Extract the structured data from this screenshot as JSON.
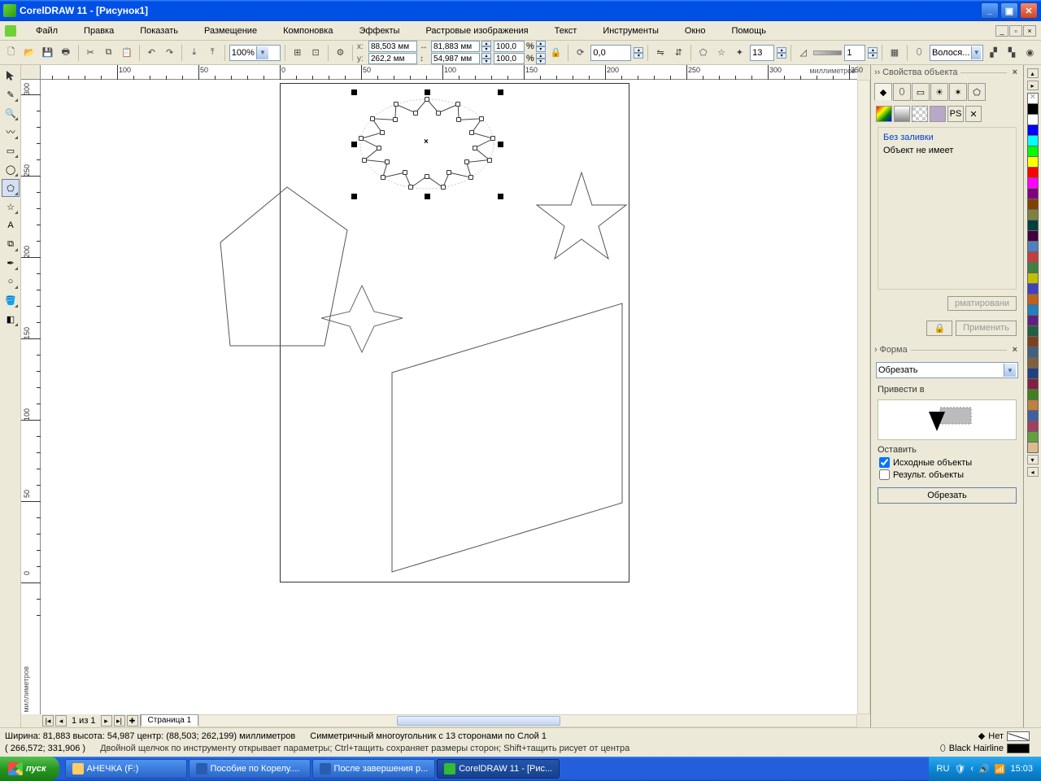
{
  "title": "CorelDRAW 11 - [Рисунок1]",
  "menu": [
    "Файл",
    "Правка",
    "Показать",
    "Размещение",
    "Компоновка",
    "Эффекты",
    "Растровые изображения",
    "Текст",
    "Инструменты",
    "Окно",
    "Помощь"
  ],
  "menu_ul": [
    "Ф",
    "П",
    "о",
    "Р",
    "К",
    "Э",
    "а",
    "Т",
    "И",
    "О",
    "ь"
  ],
  "toolbar": {
    "zoom": "100%",
    "x": "88,503 мм",
    "y": "262,2 мм",
    "w": "81,883 мм",
    "h": "54,987 мм",
    "sx": "100,0",
    "sy": "100,0",
    "pct": "%",
    "rot": "0,0",
    "sides": "13",
    "sharp": "1",
    "outline_combo": "Волося..."
  },
  "ruler_h_label": "миллиметров",
  "ruler_v_label": "миллиметров",
  "ruler_h_ticks": [
    "100",
    "50",
    "0",
    "50",
    "100",
    "150",
    "200",
    "250",
    "300"
  ],
  "ruler_v_ticks": [
    "300",
    "250",
    "200",
    "150",
    "100",
    "50",
    "0"
  ],
  "pagenav": {
    "text": "1 из 1",
    "tab": "Страница 1"
  },
  "props": {
    "title": "Свойства объекта",
    "nofill_head": "Без заливки",
    "nofill_body": "Объект не имеет",
    "fmt_btn": "рматировани",
    "apply": "Применить"
  },
  "shape": {
    "title": "Форма",
    "combo": "Обрезать",
    "lead": "Привести в",
    "leave": "Оставить",
    "cb1": "Исходные объекты",
    "cb2": "Результ. объекты",
    "btn": "Обрезать"
  },
  "status": {
    "line1a": "Ширина: 81,883  высота: 54,987  центр: (88,503; 262,199)  миллиметров",
    "line1b": "Симметричный многоугольник с 13 сторонами по Слой 1",
    "line2a": "( 266,572; 331,906 )",
    "line2b": "Двойной щелчок по инструменту открывает параметры; Ctrl+тащить сохраняет размеры сторон; Shift+тащить рисует от центра",
    "fill_none": "Нет",
    "outline": "Black  Hairline"
  },
  "taskbar": {
    "start": "пуск",
    "tasks": [
      "АНЕЧКА (F:)",
      "Пособие по Корелу....",
      "После завершения р...",
      "CorelDRAW 11 - [Рис..."
    ],
    "lang": "RU",
    "clock": "15:03"
  },
  "colors": [
    "#000000",
    "#FFFFFF",
    "#0000FF",
    "#00FFFF",
    "#00FF00",
    "#FFFF00",
    "#FF0000",
    "#FF00FF",
    "#800080",
    "#804000",
    "#808040",
    "#004040",
    "#400040",
    "#5080C0",
    "#C04040",
    "#408040",
    "#C0C000",
    "#4040C0",
    "#C06020",
    "#2080C0",
    "#602080",
    "#206040",
    "#804020",
    "#406080",
    "#806040",
    "#204080",
    "#802040",
    "#408020",
    "#C08040",
    "#4060A0",
    "#A04060",
    "#60A040",
    "#DDBB90"
  ]
}
